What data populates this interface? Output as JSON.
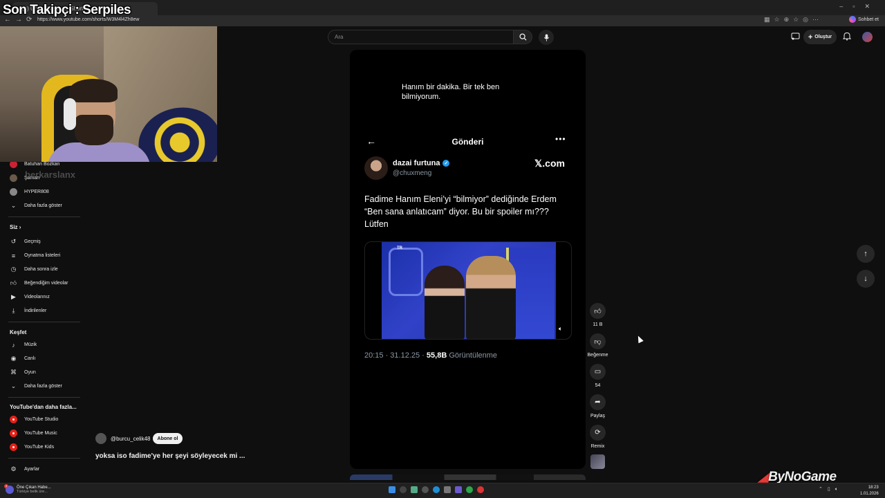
{
  "overlay": {
    "title": "Son Takipçi : Serpiles"
  },
  "browser": {
    "tab_title": "(9) Ünlü - YouTube Shorts",
    "url": "https://www.youtube.com/shorts/W3M4l4Zh8ew",
    "chat_label": "Sohbet et"
  },
  "youtube": {
    "search_placeholder": "Ara",
    "create_label": "Oluştur"
  },
  "sidebar": {
    "subscriptions": [
      {
        "label": "Batuhan Bozkan"
      },
      {
        "label": "Şaman"
      },
      {
        "label": "HYPER808"
      }
    ],
    "show_more": "Daha fazla göster",
    "you_heading": "Siz",
    "you_items": [
      {
        "label": "Geçmiş",
        "icon": "history-icon"
      },
      {
        "label": "Oynatma listeleri",
        "icon": "playlist-icon"
      },
      {
        "label": "Daha sonra izle",
        "icon": "clock-icon"
      },
      {
        "label": "Beğendiğim videolar",
        "icon": "thumbs-up-icon"
      },
      {
        "label": "Videolarınız",
        "icon": "video-icon"
      },
      {
        "label": "İndirilenler",
        "icon": "download-icon"
      }
    ],
    "explore_heading": "Keşfet",
    "explore_items": [
      {
        "label": "Müzik",
        "icon": "music-icon"
      },
      {
        "label": "Canlı",
        "icon": "live-icon"
      },
      {
        "label": "Oyun",
        "icon": "gamepad-icon"
      }
    ],
    "explore_more": "Daha fazla göster",
    "more_heading": "YouTube'dan daha fazla...",
    "more_items": [
      {
        "label": "YouTube Studio"
      },
      {
        "label": "YouTube Music"
      },
      {
        "label": "YouTube Kids"
      }
    ],
    "settings": "Ayarlar",
    "tiktok_watermark": "berkarslanx"
  },
  "short": {
    "caption": "Hanım bir dakika. Bir tek ben bilmiyorum.",
    "post_header": "Gönderi",
    "display_name": "dazai furtuna",
    "handle": "@chuxmeng",
    "platform": "𝕏.com",
    "tweet_text": "Fadime Hanım Eleni’yi “bilmiyor” dediğinde Erdem “Ben sana anlatıcam” diyor. Bu bir spoiler mı??? Lütfen",
    "tv_logo": "TR",
    "meta_time": "20:15 · 31.12.25 · ",
    "meta_views": "55,8B",
    "meta_views_label": " Görüntülenme"
  },
  "actions": {
    "like_count": "11 B",
    "dislike_label": "Beğenme",
    "comment_count": "54",
    "share_label": "Paylaş",
    "remix_label": "Remix"
  },
  "channel": {
    "handle": "@burcu_celik48",
    "subscribe_label": "Abone ol",
    "short_title": "yoksa iso fadime'ye her şeyi söyleyecek mi ..."
  },
  "watermark": {
    "brand_a": "ByNo",
    "brand_b": "Game"
  },
  "taskbar": {
    "news_title": "Öne Çıkan Habe...",
    "news_sub": "Türkiye belik üre...",
    "news_badge": "3",
    "time": "18:23",
    "date": "1.01.2026"
  }
}
